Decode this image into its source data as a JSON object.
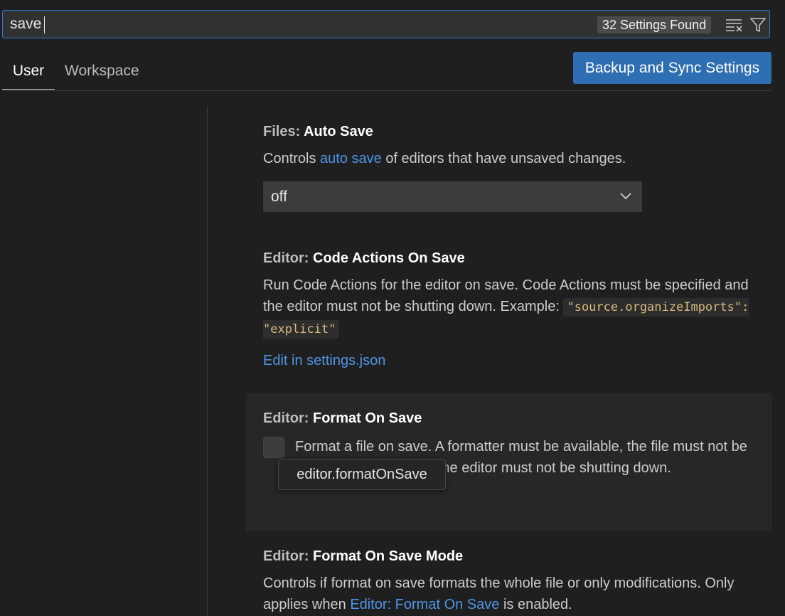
{
  "search": {
    "value": "save",
    "results_count": "32 Settings Found"
  },
  "tabs": [
    {
      "label": "User",
      "active": true
    },
    {
      "label": "Workspace",
      "active": false
    }
  ],
  "sync_button_label": "Backup and Sync Settings",
  "settings": {
    "auto_save": {
      "category": "Files: ",
      "name": "Auto Save",
      "desc_pre": "Controls ",
      "desc_link": "auto save",
      "desc_post": " of editors that have unsaved changes.",
      "value": "off"
    },
    "code_actions": {
      "category": "Editor: ",
      "name": "Code Actions On Save",
      "desc": "Run Code Actions for the editor on save. Code Actions must be specified and the editor must not be shutting down. Example: ",
      "code": "\"source.organizeImports\": \"explicit\"",
      "edit_link": "Edit in settings.json"
    },
    "format_on_save": {
      "category": "Editor: ",
      "name": "Format On Save",
      "desc": "Format a file on save. A formatter must be available, the file must not be saved after delay, and the editor must not be shutting down.",
      "checked": false,
      "tooltip": "editor.formatOnSave"
    },
    "format_on_save_mode": {
      "category": "Editor: ",
      "name": "Format On Save Mode",
      "desc_pre": "Controls if format on save formats the whole file or only modifications. Only applies when ",
      "desc_link": "Editor: Format On Save",
      "desc_post": " is enabled."
    }
  },
  "colors": {
    "accent": "#2e6eb3",
    "link": "#4e95e6",
    "background": "#1f1f1f"
  }
}
